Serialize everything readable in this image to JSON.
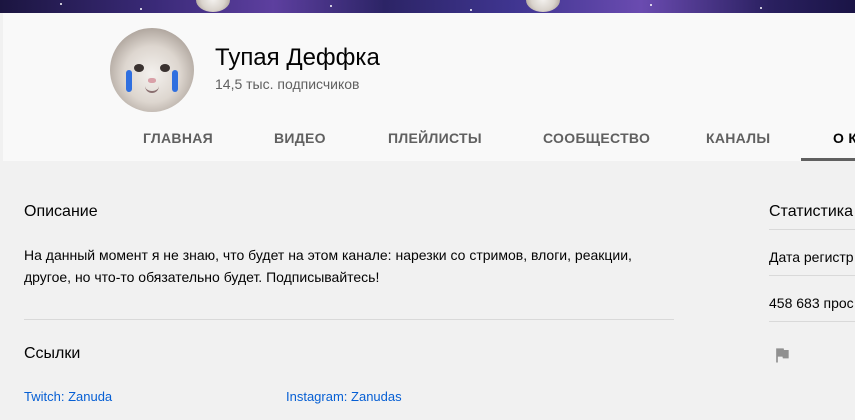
{
  "channel": {
    "name": "Тупая Деффка",
    "subscribers": "14,5 тыс. подписчиков"
  },
  "tabs": [
    {
      "label": "ГЛАВНАЯ"
    },
    {
      "label": "ВИДЕО"
    },
    {
      "label": "ПЛЕЙЛИСТЫ"
    },
    {
      "label": "СООБЩЕСТВО"
    },
    {
      "label": "КАНАЛЫ"
    },
    {
      "label": "О К"
    }
  ],
  "about": {
    "description_title": "Описание",
    "description": "На данный момент я не знаю, что будет на этом канале: нарезки со стримов, влоги, реакции, другое, но что-то обязательно будет. Подписывайтесь!",
    "links_title": "Ссылки",
    "links": [
      {
        "label": "Twitch: Zanuda"
      },
      {
        "label": "Instagram: Zanudas"
      }
    ]
  },
  "stats": {
    "title": "Статистика",
    "registration": "Дата регистр",
    "views": "458 683 прос"
  },
  "icons": {
    "report": "flag-icon"
  },
  "colors": {
    "link": "#065fd4",
    "muted": "#606060",
    "banner": "#3a2a78"
  }
}
